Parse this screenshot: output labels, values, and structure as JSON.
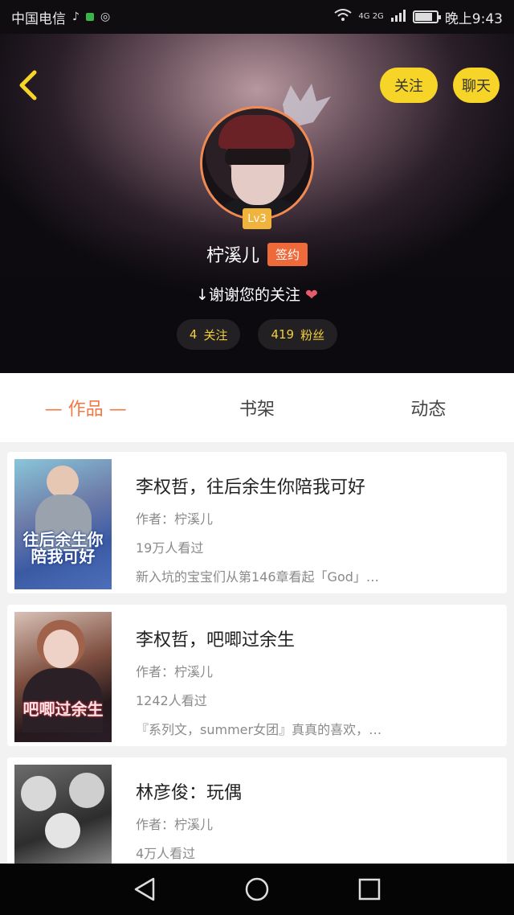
{
  "status_bar": {
    "carrier": "中国电信",
    "network": "4G 2G",
    "time": "晚上9:43",
    "battery_level": 0.8
  },
  "header": {
    "follow_label": "关注",
    "chat_label": "聊天",
    "level_badge": "Lv3",
    "username": "柠溪儿",
    "signed_badge": "签约",
    "bio": "↓谢谢您的关注",
    "bio_emoji": "❤",
    "following_count": "4",
    "following_label": "关注",
    "followers_count": "419",
    "followers_label": "粉丝"
  },
  "tabs": [
    {
      "label": "— 作品 —",
      "active": true
    },
    {
      "label": "书架",
      "active": false
    },
    {
      "label": "动态",
      "active": false
    }
  ],
  "books": [
    {
      "title": "李权哲，往后余生你陪我可好",
      "author": "作者：柠溪儿",
      "views": "19万人看过",
      "desc": "新入坑的宝宝们从第146章看起「God」…",
      "cover_text": "往后余生你陪我可好"
    },
    {
      "title": "李权哲，吧唧过余生",
      "author": "作者：柠溪儿",
      "views": "1242人看过",
      "desc": "『系列文，summer女团』真真的喜欢，…",
      "cover_text": "吧唧过余生"
    },
    {
      "title": "林彦俊：玩偶",
      "author": "作者：柠溪儿",
      "views": "4万人看过",
      "desc": "",
      "cover_text": ""
    }
  ],
  "colors": {
    "accent": "#f07a45",
    "button_yellow": "#f6d428",
    "stat_yellow": "#f2cf3a",
    "signed_badge": "#ef6a3a"
  }
}
